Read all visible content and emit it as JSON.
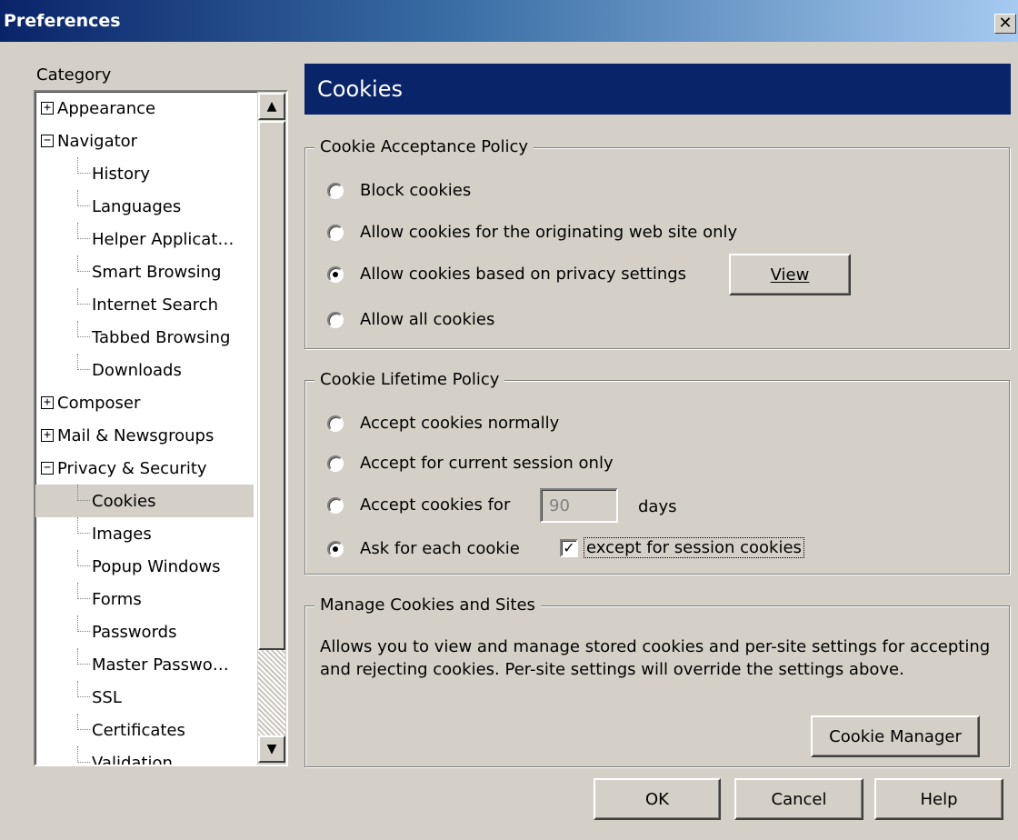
{
  "window": {
    "title": "Preferences",
    "close_glyph": "✕"
  },
  "sidebar": {
    "category_label": "Category",
    "items": [
      {
        "label": "Appearance",
        "toggle": "+"
      },
      {
        "label": "Navigator",
        "toggle": "−"
      },
      {
        "label": "History"
      },
      {
        "label": "Languages"
      },
      {
        "label": "Helper Applicat…"
      },
      {
        "label": "Smart Browsing"
      },
      {
        "label": "Internet Search"
      },
      {
        "label": "Tabbed Browsing"
      },
      {
        "label": "Downloads"
      },
      {
        "label": "Composer",
        "toggle": "+"
      },
      {
        "label": "Mail & Newsgroups",
        "toggle": "+"
      },
      {
        "label": "Privacy & Security",
        "toggle": "−"
      },
      {
        "label": "Cookies",
        "selected": true
      },
      {
        "label": "Images"
      },
      {
        "label": "Popup Windows"
      },
      {
        "label": "Forms"
      },
      {
        "label": "Passwords"
      },
      {
        "label": "Master Passwo…"
      },
      {
        "label": "SSL"
      },
      {
        "label": "Certificates"
      },
      {
        "label": "Validation"
      }
    ],
    "scroll_up_glyph": "▲",
    "scroll_down_glyph": "▼"
  },
  "panel": {
    "title": "Cookies"
  },
  "acceptance": {
    "legend": "Cookie Acceptance Policy",
    "options": [
      "Block cookies",
      "Allow cookies for the originating web site only",
      "Allow cookies based on privacy settings",
      "Allow all cookies"
    ],
    "selected_index": 2,
    "view_button": "View"
  },
  "lifetime": {
    "legend": "Cookie Lifetime Policy",
    "options": [
      "Accept cookies normally",
      "Accept for current session only",
      "Accept cookies for",
      "Ask for each cookie"
    ],
    "selected_index": 3,
    "days_value": "90",
    "days_label": "days",
    "session_checkbox_label": "except for session cookies",
    "session_checkbox_checked": true,
    "check_glyph": "✓"
  },
  "manage": {
    "legend": "Manage Cookies and Sites",
    "description": "Allows you to view and manage stored cookies and per-site settings for accepting and rejecting cookies. Per-site settings will override the settings above.",
    "manager_button": "Cookie Manager"
  },
  "footer": {
    "ok": "OK",
    "cancel": "Cancel",
    "help": "Help"
  }
}
